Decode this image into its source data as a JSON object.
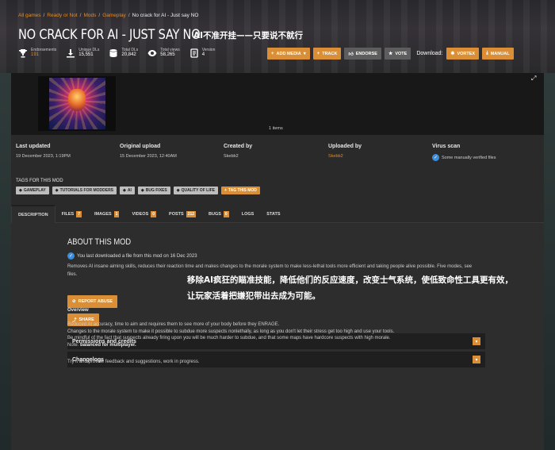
{
  "breadcrumbs": {
    "items": [
      "All games",
      "Ready or Not",
      "Mods",
      "Gameplay"
    ],
    "current": "No crack for AI - Just say NO",
    "separator": "/"
  },
  "header": {
    "title": "NO CRACK FOR AI - JUST SAY NO",
    "title_cn": "AI不准开挂——只要说不就行"
  },
  "stats": [
    {
      "icon": "trophy-icon",
      "label": "Endorsements",
      "value": "191",
      "highlight": true
    },
    {
      "icon": "download-icon",
      "label": "Unique DLs",
      "value": "15,551",
      "highlight": false
    },
    {
      "icon": "database-icon",
      "label": "Total DLs",
      "value": "20,842",
      "highlight": false
    },
    {
      "icon": "eye-icon",
      "label": "Total views",
      "value": "58,265",
      "highlight": false
    },
    {
      "icon": "version-icon",
      "label": "Version",
      "value": "4",
      "highlight": false
    }
  ],
  "actions": {
    "add_media": "ADD MEDIA",
    "track": "TRACK",
    "endorse": "ENDORSE",
    "vote": "VOTE",
    "download_label": "Download:",
    "vortex": "VORTEX",
    "manual": "MANUAL"
  },
  "gallery": {
    "items_count": "1 items"
  },
  "meta": {
    "last_updated": {
      "label": "Last updated",
      "value": "19 December 2023,  1:19PM"
    },
    "original_upload": {
      "label": "Original upload",
      "value": "15 December 2023,  12:40AM"
    },
    "created_by": {
      "label": "Created by",
      "value": "Skebb2"
    },
    "uploaded_by": {
      "label": "Uploaded by",
      "value": "Skebb2"
    },
    "virus_scan": {
      "label": "Virus scan",
      "value": "Some manually verified files"
    }
  },
  "tags": {
    "heading": "TAGS FOR THIS MOD",
    "items": [
      "GAMEPLAY",
      "TUTORIALS FOR MODDERS",
      "AI",
      "BUG FIXES",
      "QUALITY OF LIFE"
    ],
    "add_label": "TAG THIS MOD"
  },
  "tabs": [
    {
      "label": "DESCRIPTION",
      "badge": ""
    },
    {
      "label": "FILES",
      "badge": "7"
    },
    {
      "label": "IMAGES",
      "badge": "1"
    },
    {
      "label": "VIDEOS",
      "badge": "0"
    },
    {
      "label": "POSTS",
      "badge": "212"
    },
    {
      "label": "BUGS",
      "badge": "0"
    },
    {
      "label": "LOGS",
      "badge": ""
    },
    {
      "label": "STATS",
      "badge": ""
    }
  ],
  "about": {
    "heading": "ABOUT THIS MOD",
    "download_note": "You last downloaded a file from this mod on 16 Dec 2023",
    "description": "Removes AI insane aiming skills, reduces their reaction time and makes changes to the morale system to make less-lethal tools more efficient and taking people alive possible. Five modes, see files.",
    "overlay_cn": "移除AI疯狂的瞄准技能，降低他们的反应速度，改变士气系统，使低致命性工具更有效，让玩家活着把嫌犯带出去成为可能。",
    "report_abuse": "REPORT ABUSE",
    "share": "SHARE",
    "permissions": "Permissions and credits",
    "changelogs": "Changelogs"
  },
  "overview": {
    "heading": "Overview",
    "line1": "Reduced AI accuracy, time to aim and requires them to see more of your body before they ENRAGE.",
    "line2": "Changes to the morale system to make it possible to subdue more suspects nonlethally, as long as you don't let their stress get too high and use your tools.",
    "line3": "Be mindful of the fact that suspects already firing upon you will be much harder to subdue, and that some maps have hardcore suspects with high morale.",
    "line4_prefix": "Note: ",
    "line4_bold": "balanced for multiplayer.",
    "line5": "Try it and provide feedback and suggestions, work in progress."
  },
  "colors": {
    "accent": "#da8e35",
    "link": "#e08a2c",
    "panel": "#2a2a2a",
    "check": "#3a8ee0"
  }
}
